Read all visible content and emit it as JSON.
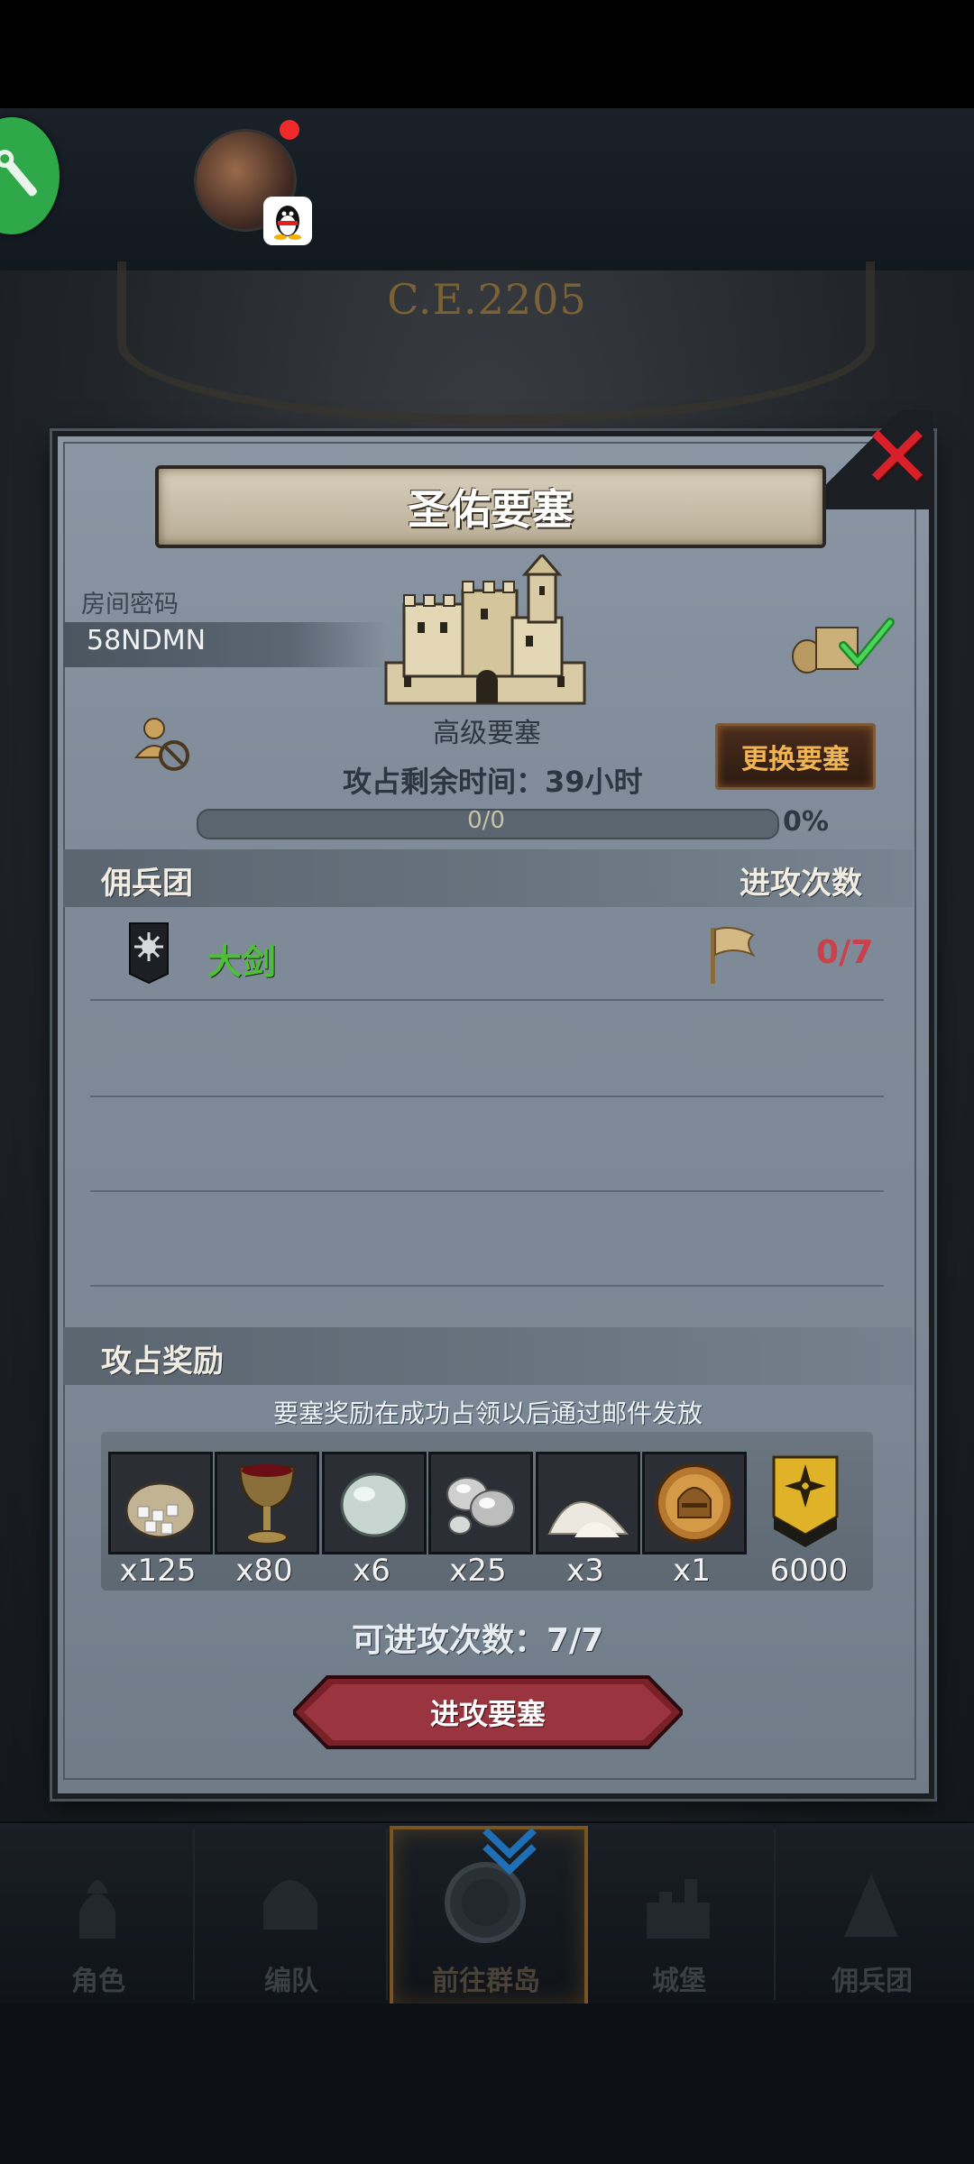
{
  "header": {
    "tool_icon": "wrench-screwdriver-icon",
    "avatar_icon": "player-avatar",
    "notification_dot_color": "#f02a2a",
    "qq_badge_icon": "qq-penguin-icon"
  },
  "background": {
    "era": "C.E.2205"
  },
  "panel": {
    "title": "圣佑要塞",
    "close_icon": "close-x-icon",
    "room_password_label": "房间密码",
    "room_password": "58NDMN",
    "fortress_level": "高级要塞",
    "change_fortress_button": "更换要塞",
    "time_remaining": "攻占剩余时间：39小时",
    "progress": {
      "text": "0/0",
      "percent_text": "0%",
      "fraction": 0
    },
    "mercenary_header": "佣兵团",
    "attack_count_header": "进攻次数",
    "mercenaries": [
      {
        "name": "大剑",
        "attacks": "0/7",
        "name_color": "#4fbf3a",
        "attacks_color": "#c8414c"
      }
    ],
    "reward_header": "攻占奖励",
    "reward_note": "要塞奖励在成功占领以后通过邮件发放",
    "rewards": [
      {
        "icon": "sugar-sack-icon",
        "qty": "x125"
      },
      {
        "icon": "goblet-icon",
        "qty": "x80"
      },
      {
        "icon": "gem-stone-icon",
        "qty": "x6"
      },
      {
        "icon": "silver-ore-icon",
        "qty": "x25"
      },
      {
        "icon": "salt-pile-icon",
        "qty": "x3"
      },
      {
        "icon": "knight-helmet-medal-icon",
        "qty": "x1"
      },
      {
        "icon": "rank-badge-icon",
        "qty": "6000"
      }
    ],
    "attacks_available": "可进攻次数：7/7",
    "attack_button": "进攻要塞"
  },
  "nav": {
    "items": [
      {
        "label": "角色",
        "icon": "character-knight-icon"
      },
      {
        "label": "编队",
        "icon": "formation-helmet-icon"
      },
      {
        "label": "前往群岛",
        "icon": "compass-islands-icon",
        "active": true
      },
      {
        "label": "城堡",
        "icon": "castle-icon"
      },
      {
        "label": "佣兵团",
        "icon": "mercenary-icon"
      }
    ]
  },
  "colors": {
    "accent_gold": "#f0b552",
    "panel": "#7f8b98",
    "attack_button": "#8a2a32"
  }
}
